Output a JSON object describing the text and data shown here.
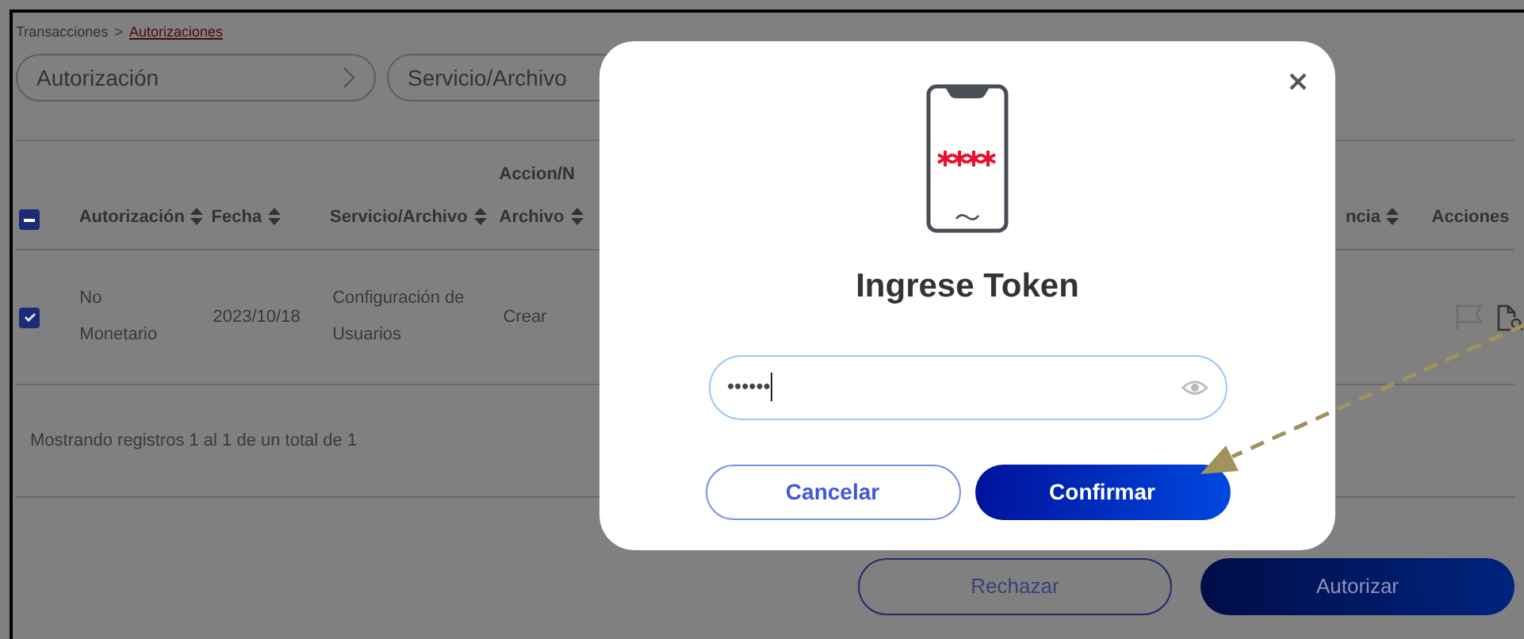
{
  "breadcrumb": {
    "items": [
      {
        "label": "Transacciones",
        "link": false
      },
      {
        "label": "Autorizaciones",
        "link": true
      }
    ],
    "separator": ">"
  },
  "filters": [
    {
      "label": "Autorización",
      "chevron": true
    },
    {
      "label": "Servicio/Archivo"
    }
  ],
  "table": {
    "header_checkbox": {
      "indeterminate": true
    },
    "columns": [
      {
        "lines": [
          "Autorización"
        ],
        "sortable": true
      },
      {
        "lines": [
          "Fecha"
        ],
        "sortable": true
      },
      {
        "lines": [
          "Servicio/Archivo"
        ],
        "sortable": true
      },
      {
        "lines": [
          "Accion/N",
          "Archivo"
        ],
        "sortable": true
      },
      {
        "lines": [
          "ncia"
        ],
        "sortable": true
      },
      {
        "lines": [
          "Acciones"
        ],
        "sortable": false
      }
    ],
    "rows": [
      {
        "selected": true,
        "cells": [
          "No Monetario",
          "2023/10/18",
          "Configuración de Usuarios",
          "Crear"
        ],
        "flag_enabled": false
      }
    ]
  },
  "footer_text": "Mostrando registros 1 al 1 de un total de 1",
  "actions": [
    {
      "label": "Rechazar",
      "kind": "outline"
    },
    {
      "label": "Autorizar",
      "kind": "primary"
    }
  ],
  "modal": {
    "title": "Ingrese Token",
    "token_field": {
      "value": "••••••",
      "focused": true
    },
    "buttons": [
      {
        "label": "Cancelar",
        "kind": "outline"
      },
      {
        "label": "Confirmar",
        "kind": "primary"
      }
    ]
  }
}
